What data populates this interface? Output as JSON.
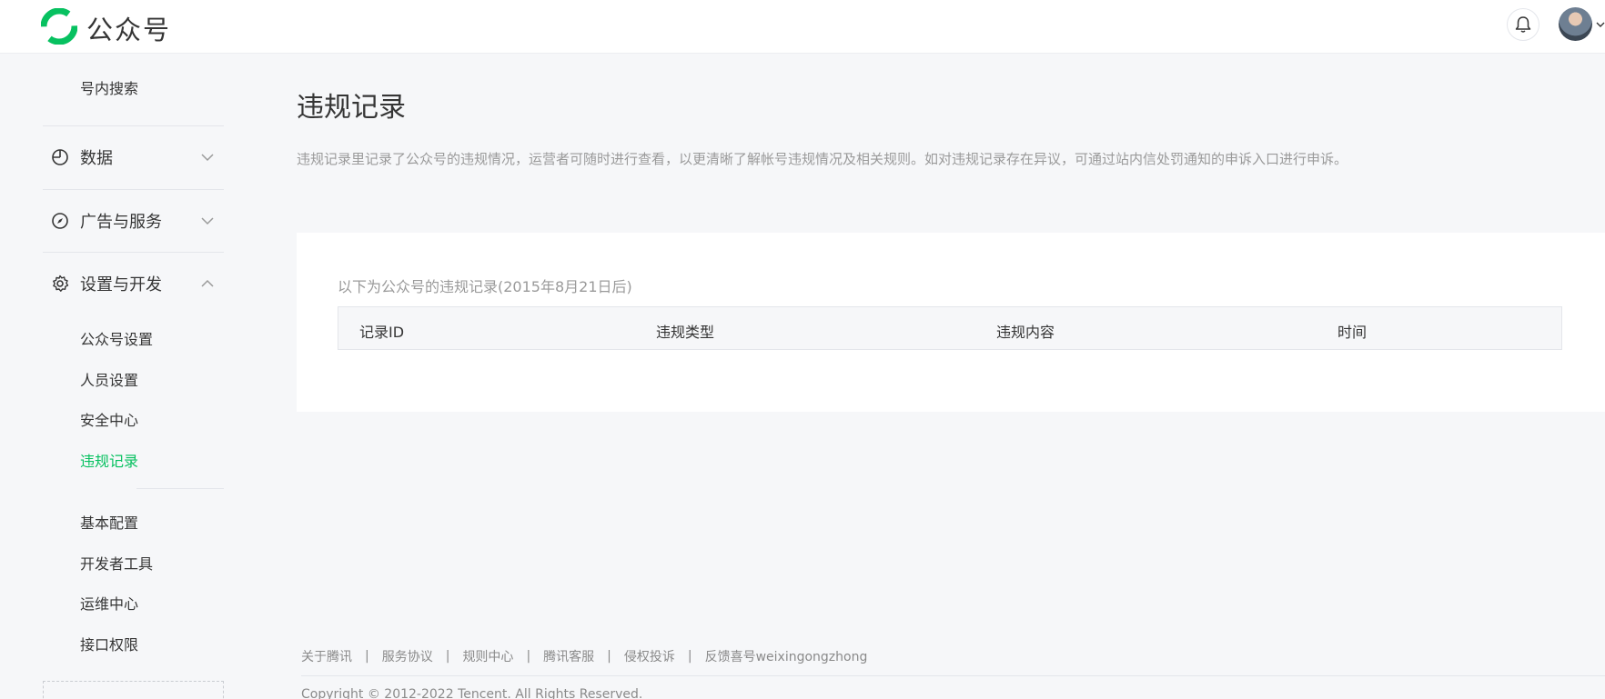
{
  "header": {
    "brand": "公众号",
    "logo_icon": "wechat-official-account-logo",
    "notification_icon": "bell-icon",
    "avatar_icon": "user-avatar"
  },
  "sidebar": {
    "top_item": "号内搜索",
    "groups": [
      {
        "label": "数据",
        "icon": "clock-chart-icon",
        "expanded": false
      },
      {
        "label": "广告与服务",
        "icon": "compass-icon",
        "expanded": false
      },
      {
        "label": "设置与开发",
        "icon": "gear-icon",
        "expanded": true
      }
    ],
    "settings_items": [
      "公众号设置",
      "人员设置",
      "安全中心",
      "违规记录"
    ],
    "dev_items": [
      "基本配置",
      "开发者工具",
      "运维中心",
      "接口权限"
    ],
    "active_item": "违规记录",
    "accent_color": "#07c160"
  },
  "main": {
    "title": "违规记录",
    "description": "违规记录里记录了公众号的违规情况，运营者可随时进行查看，以更清晰了解帐号违规情况及相关规则。如对违规记录存在异议，可通过站内信处罚通知的申诉入口进行申诉。",
    "table_caption": "以下为公众号的违规记录(2015年8月21日后)",
    "columns": [
      "记录ID",
      "违规类型",
      "违规内容",
      "时间"
    ]
  },
  "footer": {
    "links": [
      "关于腾讯",
      "服务协议",
      "规则中心",
      "腾讯客服",
      "侵权投诉",
      "反馈喜号weixingongzhong"
    ],
    "separator": "|",
    "copyright": "Copyright © 2012-2022 Tencent. All Rights Reserved."
  }
}
